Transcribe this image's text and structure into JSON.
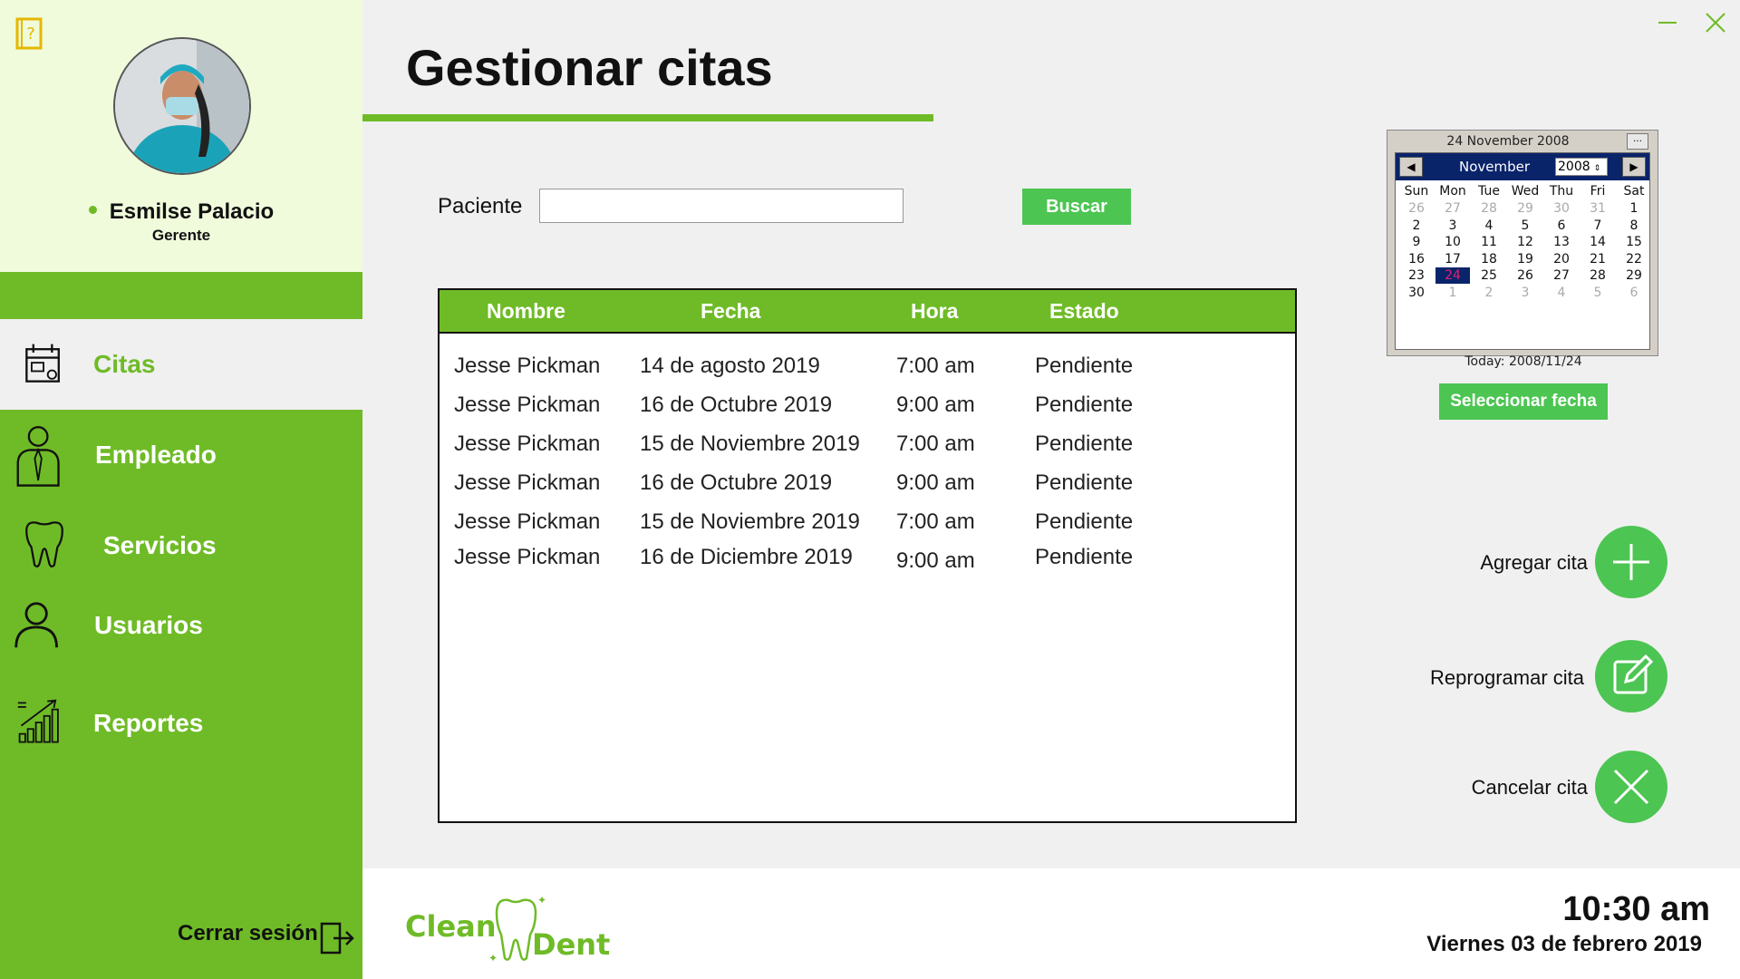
{
  "colors": {
    "brand_green": "#6fbb27",
    "button_green": "#4cc552",
    "profile_bg": "#f0fbdc"
  },
  "profile": {
    "name": "Esmilse Palacio",
    "role": "Gerente",
    "status": "online"
  },
  "nav": [
    {
      "label": "Citas",
      "icon": "calendar-icon",
      "active": true
    },
    {
      "label": "Empleado",
      "icon": "employee-icon",
      "active": false
    },
    {
      "label": "Servicios",
      "icon": "tooth-icon",
      "active": false
    },
    {
      "label": "Usuarios",
      "icon": "user-icon",
      "active": false
    },
    {
      "label": "Reportes",
      "icon": "chart-icon",
      "active": false
    }
  ],
  "logout": {
    "label": "Cerrar sesión"
  },
  "page": {
    "title": "Gestionar citas"
  },
  "search": {
    "label": "Paciente",
    "value": "",
    "button": "Buscar"
  },
  "table": {
    "headers": [
      "Nombre",
      "Fecha",
      "Hora",
      "Estado"
    ],
    "rows": [
      [
        "Jesse Pickman",
        "14 de agosto 2019",
        "7:00 am",
        "Pendiente"
      ],
      [
        "Jesse Pickman",
        "16 de Octubre 2019",
        "9:00 am",
        "Pendiente"
      ],
      [
        "Jesse Pickman",
        "15 de Noviembre 2019",
        "7:00 am",
        "Pendiente"
      ],
      [
        "Jesse Pickman",
        "16 de Octubre 2019",
        "9:00 am",
        "Pendiente"
      ],
      [
        "Jesse Pickman",
        "15 de Noviembre 2019",
        "7:00 am",
        "Pendiente"
      ],
      [
        "Jesse Pickman",
        "16 de Diciembre 2019",
        "9:00 am",
        "Pendiente"
      ]
    ]
  },
  "calendar": {
    "header": "24 November 2008",
    "month": "November",
    "year": "2008",
    "day_names": [
      "Sun",
      "Mon",
      "Tue",
      "Wed",
      "Thu",
      "Fri",
      "Sat"
    ],
    "weeks": [
      [
        "26",
        "27",
        "28",
        "29",
        "30",
        "31",
        "1"
      ],
      [
        "2",
        "3",
        "4",
        "5",
        "6",
        "7",
        "8"
      ],
      [
        "9",
        "10",
        "11",
        "12",
        "13",
        "14",
        "15"
      ],
      [
        "16",
        "17",
        "18",
        "19",
        "20",
        "21",
        "22"
      ],
      [
        "23",
        "24",
        "25",
        "26",
        "27",
        "28",
        "29"
      ],
      [
        "30",
        "1",
        "2",
        "3",
        "4",
        "5",
        "6"
      ]
    ],
    "selected": "24",
    "today": "Today: 2008/11/24",
    "select_button": "Seleccionar fecha"
  },
  "actions": {
    "add": "Agregar cita",
    "reschedule": "Reprogramar cita",
    "cancel": "Cancelar cita"
  },
  "logo": {
    "word1": "Clean",
    "word2": "Dent"
  },
  "clock": {
    "time": "10:30 am",
    "date": "Viernes 03 de febrero 2019"
  }
}
